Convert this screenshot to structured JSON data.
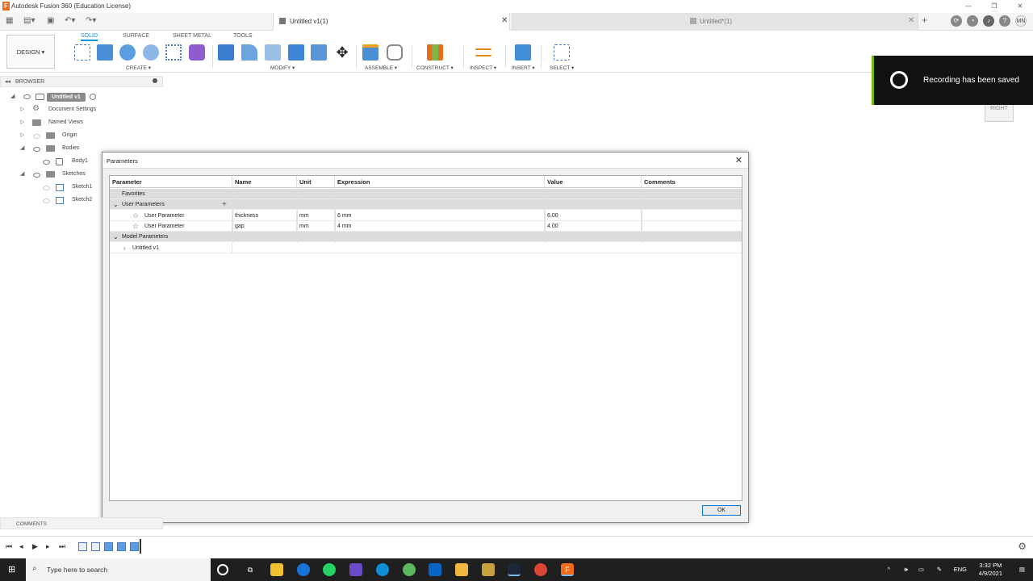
{
  "app_title": "Autodesk Fusion 360 (Education License)",
  "window_controls": {
    "minimize": "—",
    "restore": "❐",
    "close": "✕"
  },
  "tabs": [
    {
      "label": "Untitled v1(1)",
      "close": "✕"
    },
    {
      "label": "Untitled*(1)",
      "close": "✕"
    }
  ],
  "new_tab": "+",
  "user_initials": "MN",
  "toolbar": {
    "design": "DESIGN ▾",
    "workspace_tabs": [
      "SOLID",
      "SURFACE",
      "SHEET METAL",
      "TOOLS"
    ],
    "groups": [
      "CREATE ▾",
      "MODIFY ▾",
      "ASSEMBLE ▾",
      "CONSTRUCT ▾",
      "INSPECT ▾",
      "INSERT ▾",
      "SELECT ▾"
    ]
  },
  "browser": {
    "title": "BROWSER",
    "root": "Untitled v1",
    "items": [
      "Document Settings",
      "Named Views",
      "Origin",
      "Bodies",
      "Body1",
      "Sketches",
      "Sketch1",
      "Sketch2"
    ]
  },
  "viewcube": "RIGHT",
  "toast": {
    "text": "Recording has been saved"
  },
  "dialog": {
    "title": "Parameters",
    "close": "✕",
    "columns": [
      "Parameter",
      "Name",
      "Unit",
      "Expression",
      "Value",
      "Comments"
    ],
    "favorites": "Favorites",
    "user_params_label": "User Parameters",
    "add": "+",
    "user_params": [
      {
        "parameter": "User Parameter",
        "name": "thickness",
        "unit": "mm",
        "expression": "6 mm",
        "value": "6.00"
      },
      {
        "parameter": "User Parameter",
        "name": "gap",
        "unit": "mm",
        "expression": "4 mm",
        "value": "4.00"
      }
    ],
    "model_params_label": "Model Parameters",
    "model_child": "Untitled v1",
    "ok": "OK"
  },
  "comments": "COMMENTS",
  "taskbar": {
    "search_placeholder": "Type here to search",
    "language": "ENG",
    "time": "3:32 PM",
    "date": "4/9/2021"
  }
}
